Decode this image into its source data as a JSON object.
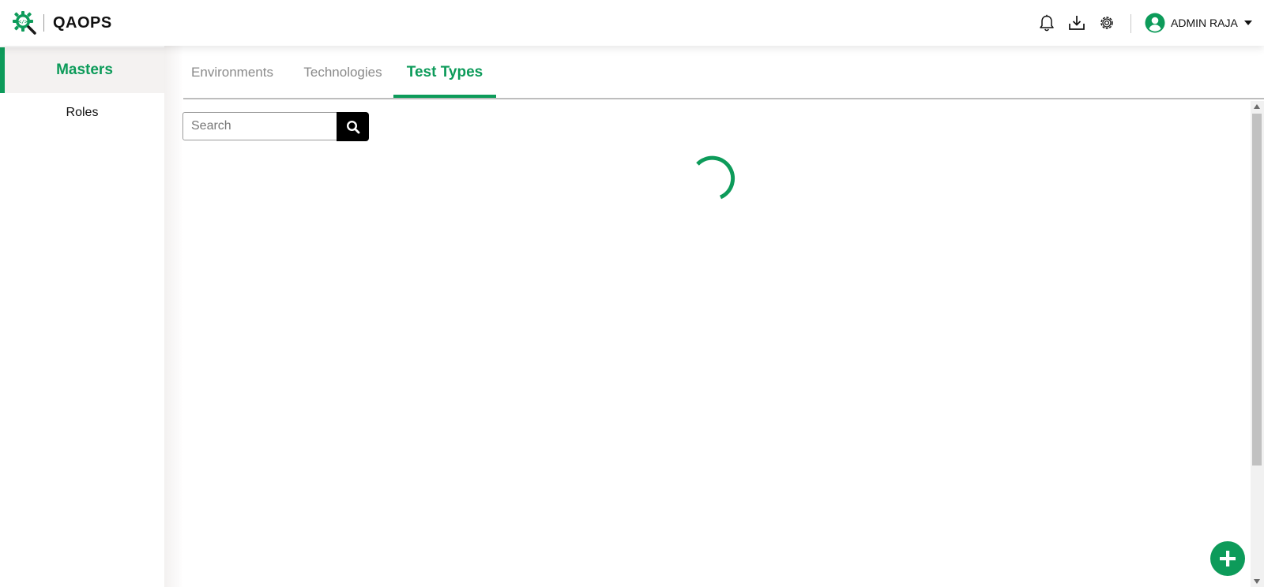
{
  "app": {
    "title": "QAOPS",
    "accent_color": "#0d9b5a"
  },
  "header": {
    "icons": [
      "logo-gear-code-icon",
      "bell-icon",
      "download-icon",
      "gear-icon"
    ],
    "user": {
      "name": "ADMIN RAJA",
      "avatar_icon": "user-circle-icon"
    }
  },
  "sidebar": {
    "items": [
      {
        "label": "Masters",
        "active": true
      },
      {
        "label": "Roles",
        "active": false
      }
    ]
  },
  "tabs": [
    {
      "label": "Environments",
      "active": false
    },
    {
      "label": "Technologies",
      "active": false
    },
    {
      "label": "Test Types",
      "active": true
    }
  ],
  "search": {
    "placeholder": "Search",
    "value": ""
  },
  "content": {
    "loading": true
  },
  "fab": {
    "icon": "plus-icon"
  }
}
